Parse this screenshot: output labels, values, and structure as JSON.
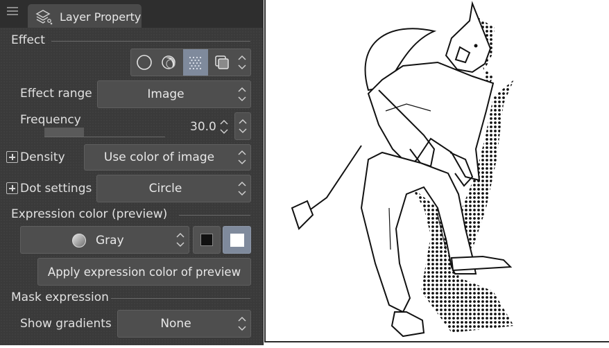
{
  "panel": {
    "tab_title": "Layer Property"
  },
  "effect": {
    "section_label": "Effect",
    "icons": [
      "circle-effect-icon",
      "border-effect-icon",
      "tone-effect-icon",
      "layer-color-icon"
    ],
    "selected_icon": "tone-effect-icon",
    "range_label": "Effect range",
    "range_value": "Image",
    "frequency_label": "Frequency",
    "frequency_value": "30.0",
    "frequency_slider_fraction": 0.33,
    "density_label": "Density",
    "density_value": "Use color of image",
    "dot_label": "Dot settings",
    "dot_value": "Circle"
  },
  "expression": {
    "section_label": "Expression color (preview)",
    "color_value": "Gray",
    "apply_button": "Apply expression color of preview"
  },
  "mask": {
    "section_label": "Mask expression",
    "gradients_label": "Show gradients",
    "gradients_value": "None"
  },
  "colors": {
    "panel_bg": "#3a3a3a",
    "selected_icon_bg": "#7f8a9c",
    "control_bg": "#4e4e4e"
  }
}
